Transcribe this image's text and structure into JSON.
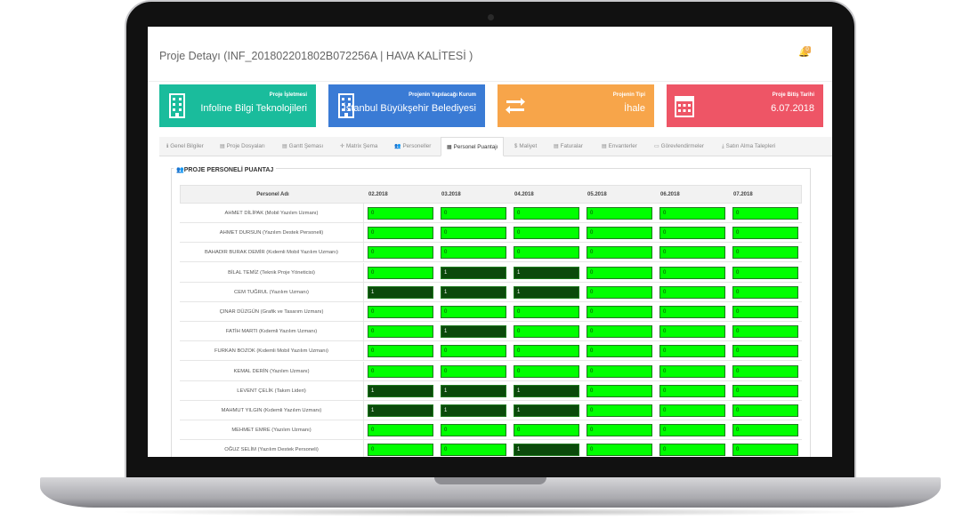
{
  "page": {
    "title": "Proje Detayı (INF_201802201802B072256A | HAVA KALİTESİ )",
    "notification_count": "0"
  },
  "cards": [
    {
      "label": "Proje İşletmesi",
      "value": "Infoline Bilgi Teknolojileri",
      "color": "#1abc9c",
      "icon": "building-icon"
    },
    {
      "label": "Projenin Yapılacağı Kurum",
      "value": "İstanbul Büyükşehir Belediyesi",
      "color": "#3a7bd5",
      "icon": "building-icon"
    },
    {
      "label": "Projenin Tipi",
      "value": "İhale",
      "color": "#f7a54a",
      "icon": "exchange-icon"
    },
    {
      "label": "Proje Bitiş Tarihi",
      "value": "6.07.2018",
      "color": "#ee5566",
      "icon": "calendar-icon"
    }
  ],
  "tabs": [
    {
      "label": "Genel Bilgiler",
      "icon": "ℹ"
    },
    {
      "label": "Proje Dosyaları",
      "icon": "▤"
    },
    {
      "label": "Gantt Şeması",
      "icon": "▤"
    },
    {
      "label": "Matrix Şema",
      "icon": "✛"
    },
    {
      "label": "Personeller",
      "icon": "👥"
    },
    {
      "label": "Personel Puantajı",
      "icon": "▦"
    },
    {
      "label": "Maliyet",
      "icon": "$"
    },
    {
      "label": "Faturalar",
      "icon": "▤"
    },
    {
      "label": "Envanterler",
      "icon": "▤"
    },
    {
      "label": "Görevlendirmeler",
      "icon": "▭"
    },
    {
      "label": "Satın Alma Talepleri",
      "icon": "⤓"
    }
  ],
  "section": {
    "title": "PROJE PERSONELİ PUANTAJ"
  },
  "table": {
    "headers": [
      "Personel Adı",
      "02.2018",
      "03.2018",
      "04.2018",
      "05.2018",
      "06.2018",
      "07.2018"
    ],
    "rows": [
      {
        "name": "AHMET DİLİPAK (Mobil Yazılım Uzmanı)",
        "values": [
          "0",
          "0",
          "0",
          "0",
          "0",
          "0"
        ]
      },
      {
        "name": "AHMET DURSUN (Yazılım Destek Personeli)",
        "values": [
          "0",
          "0",
          "0",
          "0",
          "0",
          "0"
        ]
      },
      {
        "name": "BAHADIR BURAK DEMİR (Kıdemli Mobil Yazılım Uzmanı)",
        "values": [
          "0",
          "0",
          "0",
          "0",
          "0",
          "0"
        ]
      },
      {
        "name": "BİLAL TEMİZ (Teknik Proje Yöneticisi)",
        "values": [
          "0",
          "1",
          "1",
          "0",
          "0",
          "0"
        ]
      },
      {
        "name": "CEM TUĞRUL (Yazılım Uzmanı)",
        "values": [
          "1",
          "1",
          "1",
          "0",
          "0",
          "0"
        ]
      },
      {
        "name": "ÇINAR DÜZGÜN (Grafik ve Tasarım Uzmanı)",
        "values": [
          "0",
          "0",
          "0",
          "0",
          "0",
          "0"
        ]
      },
      {
        "name": "FATİH MARTI (Kıdemli Yazılım Uzmanı)",
        "values": [
          "0",
          "1",
          "0",
          "0",
          "0",
          "0"
        ]
      },
      {
        "name": "FURKAN BOZOK (Kıdemli Mobil Yazılım Uzmanı)",
        "values": [
          "0",
          "0",
          "0",
          "0",
          "0",
          "0"
        ]
      },
      {
        "name": "KEMAL DERİN (Yazılım Uzmanı)",
        "values": [
          "0",
          "0",
          "0",
          "0",
          "0",
          "0"
        ]
      },
      {
        "name": "LEVENT ÇELİK (Takım Lideri)",
        "values": [
          "1",
          "1",
          "1",
          "0",
          "0",
          "0"
        ]
      },
      {
        "name": "MAHMUT YILGIN (Kıdemli Yazılım Uzmanı)",
        "values": [
          "1",
          "1",
          "1",
          "0",
          "0",
          "0"
        ]
      },
      {
        "name": "MEHMET EMRE (Yazılım Uzmanı)",
        "values": [
          "0",
          "0",
          "0",
          "0",
          "0",
          "0"
        ]
      },
      {
        "name": "OĞUZ SELİM (Yazılım Destek Personeli)",
        "values": [
          "0",
          "0",
          "1",
          "0",
          "0",
          "0"
        ]
      }
    ]
  }
}
